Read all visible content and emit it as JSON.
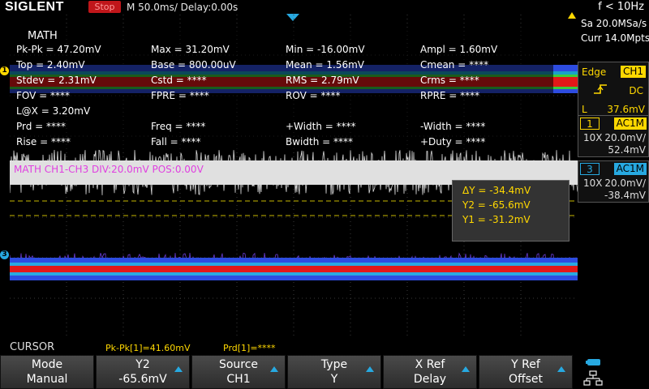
{
  "header": {
    "brand": "SIGLENT",
    "run_state": "Stop",
    "timebase": "M 50.0ms/ Delay:0.00s",
    "frequency": "f < 10Hz"
  },
  "acquisition": {
    "sample_rate": "Sa 20.0MSa/s",
    "memory": "Curr 14.0Mpts"
  },
  "trigger": {
    "type": "Edge",
    "source": "CH1",
    "coupling": "DC",
    "level_label": "L",
    "level_value": "37.6mV",
    "slope_icon": "rising-edge-icon"
  },
  "channels": [
    {
      "num": "1",
      "coupling": "AC1M",
      "probe": "10X",
      "scale": "20.0mV/",
      "offset": "52.4mV",
      "color": "#ffd800"
    },
    {
      "num": "3",
      "coupling": "AC1M",
      "probe": "10X",
      "scale": "20.0mV/",
      "offset": "-38.4mV",
      "color": "#27a9e1"
    }
  ],
  "measurements": {
    "title": "MATH",
    "rows": [
      [
        "Pk-Pk = 47.20mV",
        "Max = 31.20mV",
        "Min = -16.00mV",
        "Ampl = 1.60mV"
      ],
      [
        "Top = 2.40mV",
        "Base = 800.00uV",
        "Mean = 1.56mV",
        "Cmean = ****"
      ],
      [
        "Stdev = 2.31mV",
        "Cstd = ****",
        "RMS = 2.79mV",
        "Crms = ****"
      ],
      [
        "FOV = ****",
        "FPRE = ****",
        "ROV = ****",
        "RPRE = ****"
      ],
      [
        "L@X = 3.20mV",
        "",
        "",
        ""
      ],
      [
        "Prd = ****",
        "Freq = ****",
        "+Width = ****",
        "-Width = ****"
      ],
      [
        "Rise = ****",
        "Fall = ****",
        "Bwidth = ****",
        "+Duty = ****"
      ]
    ]
  },
  "math_label": "MATH  CH1-CH3  DIV:20.0mV  POS:0.00V",
  "cursor": {
    "delta_y": "ΔY = -34.4mV",
    "y2": "Y2 = -65.6mV",
    "y1": "Y1 = -31.2mV"
  },
  "status": {
    "menu": "CURSOR",
    "pkpk": "Pk-Pk[1]=41.60mV",
    "prd": "Prd[1]=****"
  },
  "softkeys": [
    {
      "top": "Mode",
      "bottom": "Manual",
      "arrow": false
    },
    {
      "top": "Y2",
      "bottom": "-65.6mV",
      "arrow": true
    },
    {
      "top": "Source",
      "bottom": "CH1",
      "arrow": true
    },
    {
      "top": "Type",
      "bottom": "Y",
      "arrow": true
    },
    {
      "top": "X Ref",
      "bottom": "Delay",
      "arrow": true
    },
    {
      "top": "Y Ref",
      "bottom": "Offset",
      "arrow": true
    }
  ],
  "markers": {
    "ch1": "1",
    "ch3": "3"
  },
  "colors": {
    "ch1": "#ffd800",
    "ch3": "#27a9e1",
    "math": "#e040e0",
    "accent": "#27a9e1",
    "stop": "#c0161a"
  }
}
